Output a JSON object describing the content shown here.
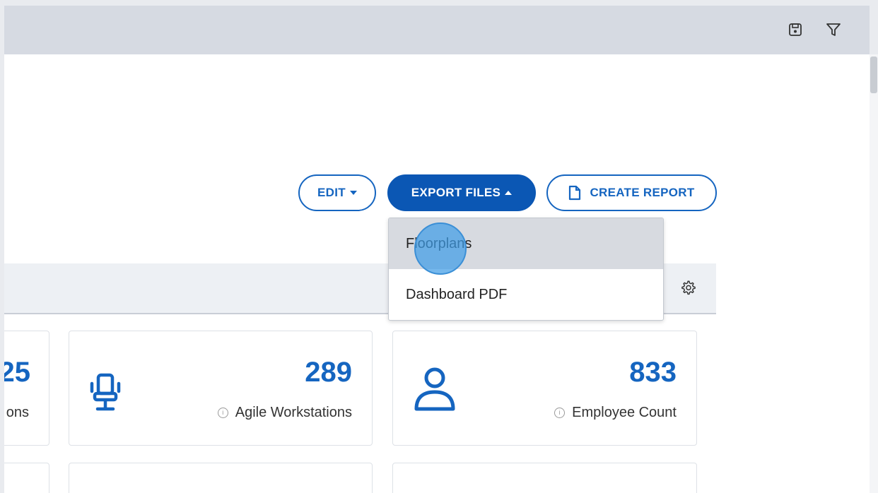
{
  "toolbar": {
    "save_icon": "floppy-disk-icon",
    "filter_icon": "funnel-icon"
  },
  "actions": {
    "edit_label": "EDIT",
    "export_label": "EXPORT FILES",
    "create_report_label": "CREATE REPORT"
  },
  "export_menu": {
    "items": [
      {
        "label": "Floorplans",
        "hovered": true
      },
      {
        "label": "Dashboard PDF",
        "hovered": false
      }
    ]
  },
  "cards": [
    {
      "value": "25",
      "label": "ons",
      "value_visible_fragment": true
    },
    {
      "value": "289",
      "label": "Agile Workstations",
      "icon": "office-chair-icon"
    },
    {
      "value": "833",
      "label": "Employee Count",
      "icon": "person-icon"
    }
  ],
  "colors": {
    "accent": "#1565c0",
    "accent_solid": "#0b57b4",
    "topbar": "#d6dae2",
    "hover": "#d7dae0"
  }
}
